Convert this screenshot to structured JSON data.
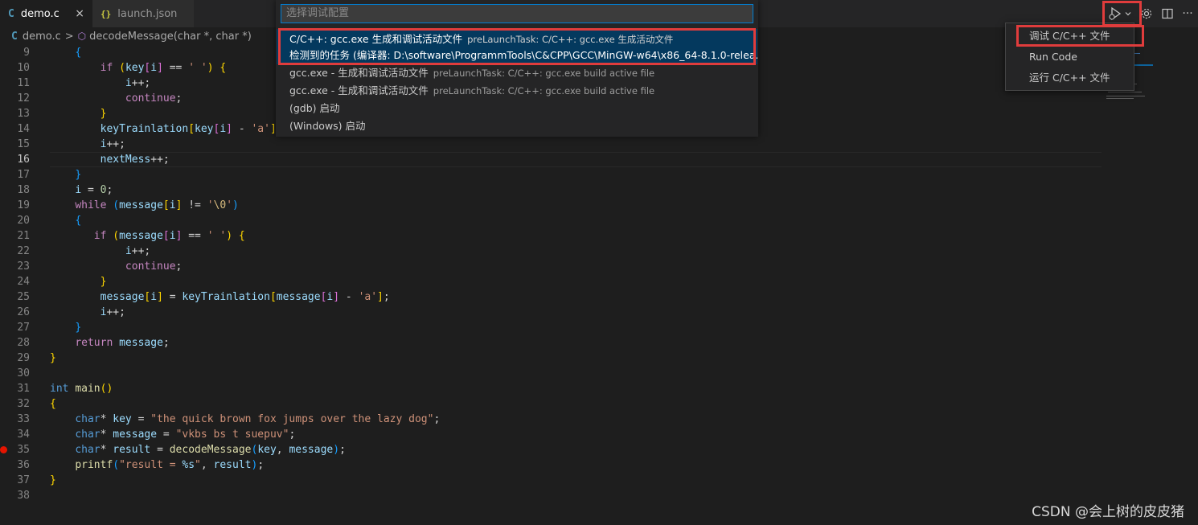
{
  "tabs": [
    {
      "icon": "C",
      "label": "demo.c",
      "close": "×"
    },
    {
      "icon": "{}",
      "label": "launch.json"
    }
  ],
  "breadcrumb": {
    "icon": "C",
    "file": "demo.c",
    "separator": ">",
    "symbol": "decodeMessage(char *, char *)"
  },
  "quickpick": {
    "placeholder": "选择调试配置",
    "items": [
      {
        "label": "C/C++: gcc.exe 生成和调试活动文件",
        "desc": "preLaunchTask: C/C++: gcc.exe 生成活动文件",
        "detail": "检测到的任务 (编译器: D:\\software\\ProgrammTools\\C&CPP\\GCC\\MinGW-w64\\x86_64-8.1.0-relea..."
      },
      {
        "label": "gcc.exe - 生成和调试活动文件",
        "desc": "preLaunchTask: C/C++: gcc.exe build active file"
      },
      {
        "label": "gcc.exe - 生成和调试活动文件",
        "desc": "preLaunchTask: C/C++: gcc.exe build active file"
      },
      {
        "label": "(gdb) 启动"
      },
      {
        "label": "(Windows) 启动"
      }
    ]
  },
  "run_menu": {
    "items": [
      "调试 C/C++ 文件",
      "Run Code",
      "运行 C/C++ 文件"
    ]
  },
  "toolbar": {
    "run_icon": "run-debug-icon",
    "chevron": "chevron-down-icon",
    "settings_icon": "gear-icon",
    "split_icon": "split-editor-icon",
    "more": "···"
  },
  "editor": {
    "current_line": 16,
    "breakpoint_line": 35,
    "line_numbers": [
      "9",
      "10",
      "11",
      "12",
      "13",
      "14",
      "15",
      "16",
      "17",
      "18",
      "19",
      "20",
      "21",
      "22",
      "23",
      "24",
      "25",
      "26",
      "27",
      "28",
      "29",
      "30",
      "31",
      "32",
      "33",
      "34",
      "35",
      "36",
      "37",
      "38"
    ]
  },
  "watermark": "CSDN @会上树的皮皮猪",
  "colors": {
    "accent": "#007fd4",
    "highlight_box": "#e03c3c",
    "selection": "#04395e",
    "breakpoint": "#e51400"
  }
}
